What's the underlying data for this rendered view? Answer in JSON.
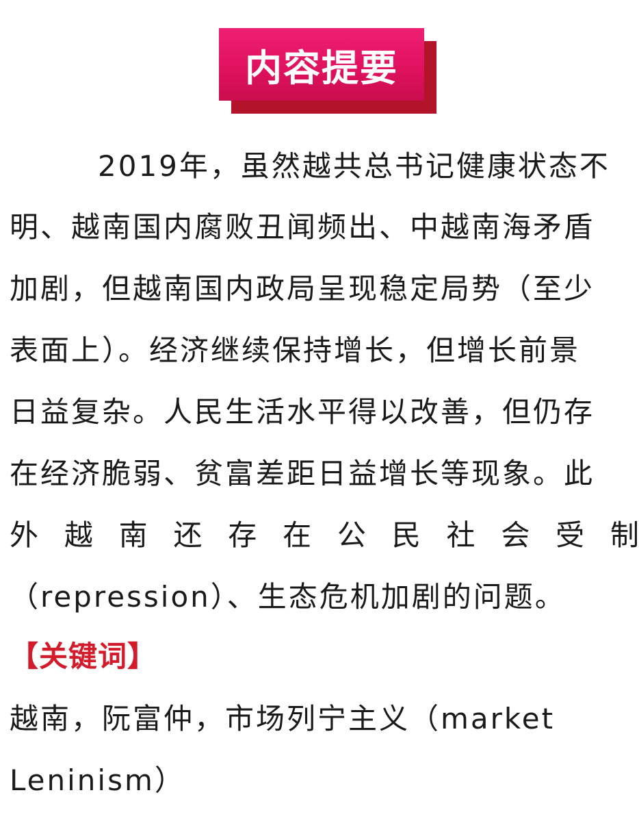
{
  "banner": {
    "title": "内容提要"
  },
  "abstract": {
    "lines": [
      "　2019年，虽然越共总书记健康状态不",
      "明、越南国内腐败丑闻频出、中越南海矛盾",
      "加剧，但越南国内政局呈现稳定局势（至少",
      "表面上）。经济继续保持增长，但增长前景",
      "日益复杂。人民生活水平得以改善，但仍存",
      "在经济脆弱、贫富差距日益增长等现象。此",
      "外越南还存在公民社会受制",
      "（repression）、生态危机加剧的问题。"
    ],
    "line7_chars": [
      "外",
      "越",
      "南",
      "还",
      "存",
      "在",
      "公",
      "民",
      "社",
      "会",
      "受",
      "制"
    ]
  },
  "keywords": {
    "title": "【关键词】",
    "line1": "越南，阮富仲，市场列宁主义（market",
    "line2": "Leninism）"
  },
  "colors": {
    "banner_bg": "#e0125f",
    "banner_shadow": "#b3142c",
    "keyword_title": "#d31c2b",
    "text": "#1a1a1a"
  }
}
